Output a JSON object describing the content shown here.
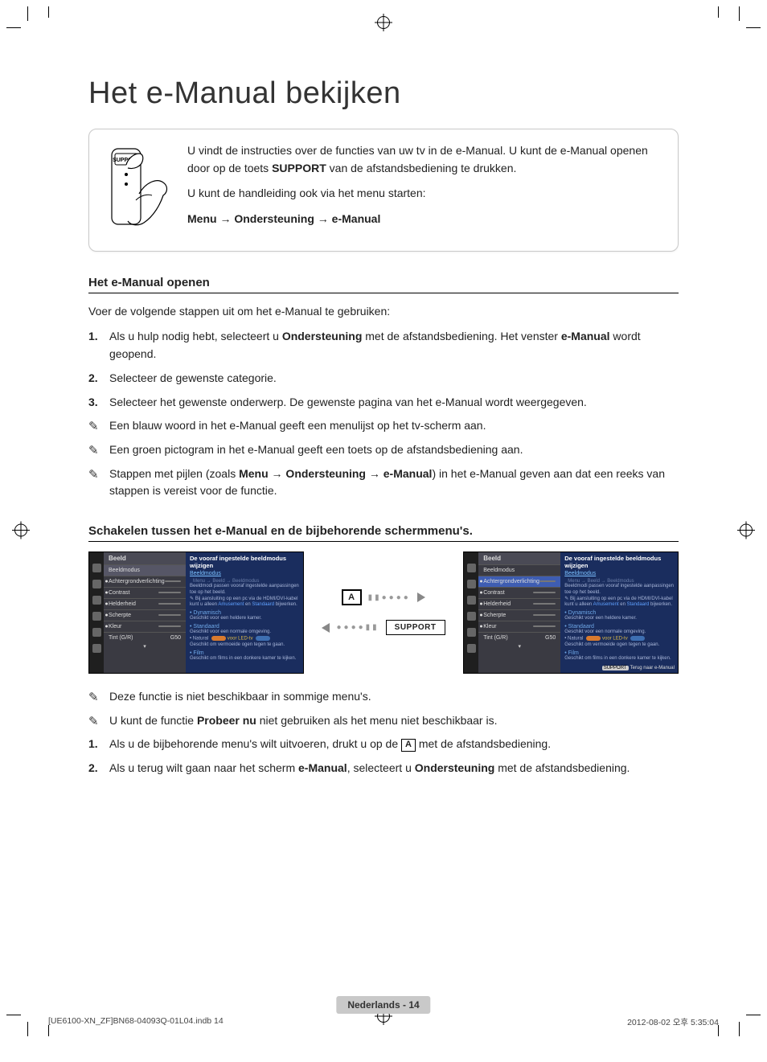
{
  "page_title": "Het e-Manual bekijken",
  "remote_button_label": "SUPPORT",
  "intro": {
    "line1_pre": "U vindt de instructies over de functies van uw tv in de e-Manual. U kunt de e-Manual openen door op de toets ",
    "line1_key": "SUPPORT",
    "line1_post": " van de afstandsbediening te drukken.",
    "line2": "U kunt de handleiding ook via het menu starten:",
    "path": "Menu → Ondersteuning → e-Manual"
  },
  "section1": {
    "heading": "Het e-Manual openen",
    "lead": "Voer de volgende stappen uit om het e-Manual te gebruiken:",
    "steps": [
      {
        "pre": "Als u hulp nodig hebt, selecteert u ",
        "b1": "Ondersteuning",
        "mid": " met de afstandsbediening. Het venster ",
        "b2": "e-Manual",
        "post": " wordt geopend."
      },
      {
        "text": "Selecteer de gewenste categorie."
      },
      {
        "text": "Selecteer het gewenste onderwerp. De gewenste pagina van het e-Manual wordt weergegeven."
      }
    ],
    "notes": [
      {
        "text": "Een blauw woord in het e-Manual geeft een menulijst op het tv-scherm aan."
      },
      {
        "text": "Een groen pictogram in het e-Manual geeft een toets op de afstandsbediening aan."
      },
      {
        "pre": "Stappen met pijlen (zoals ",
        "b1": "Menu → Ondersteuning → e-Manual",
        "post": ") in het e-Manual geven aan dat een reeks van stappen is vereist voor de functie."
      }
    ]
  },
  "section2": {
    "heading": "Schakelen tussen het e-Manual en de bijbehorende schermmenu's.",
    "key_a": "A",
    "key_support": "SUPPORT",
    "notes2": [
      {
        "text": "Deze functie is niet beschikbaar in sommige menu's."
      },
      {
        "pre": "U kunt de functie ",
        "b1": "Probeer nu",
        "post": " niet gebruiken als het menu niet beschikbaar is."
      }
    ],
    "steps2": [
      {
        "pre": "Als u de bijbehorende menu's wilt uitvoeren, drukt u op de ",
        "key": "A",
        "post": " met de afstandsbediening."
      },
      {
        "pre": "Als u terug wilt gaan naar het scherm ",
        "b1": "e-Manual",
        "mid": ", selecteert u ",
        "b2": "Ondersteuning",
        "post": " met de afstandsbediening."
      }
    ]
  },
  "tvshot": {
    "detail_title": "De vooraf ingestelde beeldmodus wijzigen",
    "detail_tab_active": "Beeldmodus",
    "detail_tab_other": "Menu → Beeld → Beeldmodus",
    "detail_desc": "Beeldmodi passen vooraf ingestelde aanpassingen toe op het beeld.",
    "detail_note_pre": "Bij aansluiting op een pc via de HDMI/DVI-kabel kunt u alleen ",
    "detail_note_blue1": "Amusement",
    "detail_note_mid": " en ",
    "detail_note_blue2": "Standaard",
    "detail_note_post": " bijwerken.",
    "bullet1": "Dynamisch",
    "bullet1_desc": "Geschikt voor een heldere kamer.",
    "bullet2": "Standaard",
    "bullet2_desc": "Geschikt voor een normale omgeving.",
    "bullet3_label": "• Natural",
    "bullet3_desc": "Geschikt om vermoeide ogen tegen te gaan.",
    "bullet4": "Film",
    "bullet4_desc": "Geschikt om films in een donkere kamer te kijken.",
    "action_label": "Terug naar e-Manual",
    "action_key": "SUPPORT",
    "menu_title": "Beeld",
    "menu_items": [
      "Beeldmodus",
      "Achtergrondverlichting",
      "Contrast",
      "Helderheid",
      "Scherpte",
      "Kleur"
    ],
    "menu_tint_label": "Tint (G/R)",
    "menu_tint_value": "G50"
  },
  "footer": {
    "badge": "Nederlands - 14",
    "file": "[UE6100-XN_ZF]BN68-04093Q-01L04.indb   14",
    "date": "2012-08-02   오후 5:35:04"
  }
}
